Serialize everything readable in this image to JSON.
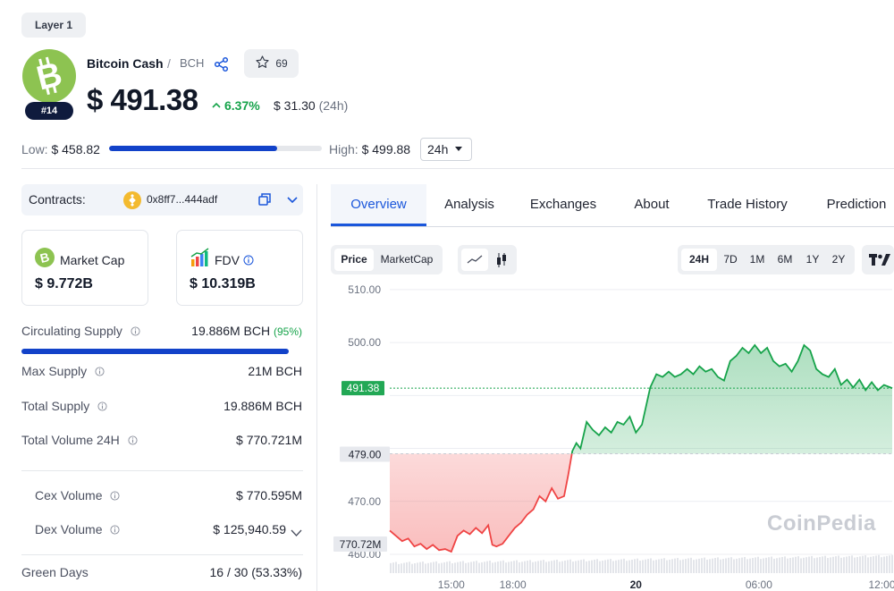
{
  "category_tag": "Layer 1",
  "coin": {
    "name": "Bitcoin Cash",
    "separator": "/",
    "symbol": "BCH",
    "rank": "#14",
    "watchlist_count": "69",
    "price": "$ 491.38",
    "change_pct": "6.37%",
    "change_abs": "$ 31.30",
    "change_period": "(24h)"
  },
  "range": {
    "low_label": "Low:",
    "low_value": "$ 458.82",
    "high_label": "High:",
    "high_value": "$ 499.88",
    "period": "24h",
    "position_fraction": 0.79
  },
  "contracts": {
    "label": "Contracts:",
    "address": "0x8ff7...444adf"
  },
  "cards": {
    "market_cap": {
      "label": "Market Cap",
      "value": "$ 9.772B"
    },
    "fdv": {
      "label": "FDV",
      "value": "$ 10.319B"
    }
  },
  "stats": {
    "circulating_supply": {
      "label": "Circulating Supply",
      "value": "19.886M BCH",
      "pct": "(95%)",
      "fill_fraction": 0.95
    },
    "max_supply": {
      "label": "Max Supply",
      "value": "21M BCH"
    },
    "total_supply": {
      "label": "Total Supply",
      "value": "19.886M BCH"
    },
    "total_volume": {
      "label": "Total Volume 24H",
      "value": "$ 770.721M"
    },
    "cex_volume": {
      "label": "Cex Volume",
      "value": "$ 770.595M"
    },
    "dex_volume": {
      "label": "Dex Volume",
      "value": "$ 125,940.59"
    },
    "green_days": {
      "label": "Green Days",
      "value": "16 / 30 (53.33%)"
    }
  },
  "tabs": [
    "Overview",
    "Analysis",
    "Exchanges",
    "About",
    "Trade History",
    "Prediction"
  ],
  "chart_controls": {
    "data_type": [
      "Price",
      "MarketCap"
    ],
    "data_type_active": "Price",
    "chart_style_active": "line",
    "ranges": [
      "24H",
      "7D",
      "1M",
      "6M",
      "1Y",
      "2Y"
    ],
    "range_active": "24H"
  },
  "watermark": "CoinPedia",
  "colors": {
    "up": "#16a34a",
    "down": "#ef4444",
    "accent": "#1a56db",
    "brand": "#8dc351"
  },
  "chart_data": {
    "type": "area",
    "x_ticks": [
      "15:00",
      "18:00",
      "20",
      "06:00",
      "12:00"
    ],
    "y_ticks": [
      "510.00",
      "500.00",
      "491.38",
      "479.00",
      "470.00",
      "460.00"
    ],
    "ylim": [
      459.5,
      512
    ],
    "baseline": 479.0,
    "last_price_label": "491.38",
    "baseline_label": "479.00",
    "volume_label": "770.72M",
    "x_range": [
      12.0,
      36.5
    ],
    "series": [
      {
        "values": [
          [
            12.0,
            464.5
          ],
          [
            12.3,
            463.5
          ],
          [
            12.6,
            462.5
          ],
          [
            12.9,
            463.0
          ],
          [
            13.2,
            461.5
          ],
          [
            13.5,
            462.0
          ],
          [
            13.8,
            461.0
          ],
          [
            14.1,
            461.8
          ],
          [
            14.4,
            460.8
          ],
          [
            14.7,
            461.0
          ],
          [
            15.0,
            460.5
          ],
          [
            15.3,
            463.5
          ],
          [
            15.6,
            464.5
          ],
          [
            15.9,
            463.8
          ],
          [
            16.2,
            465.0
          ],
          [
            16.5,
            464.0
          ],
          [
            16.8,
            465.5
          ],
          [
            17.0,
            461.8
          ],
          [
            17.2,
            461.5
          ],
          [
            17.5,
            462.0
          ],
          [
            17.8,
            463.5
          ],
          [
            18.1,
            465.0
          ],
          [
            18.4,
            466.0
          ],
          [
            18.7,
            467.5
          ],
          [
            19.0,
            468.5
          ],
          [
            19.3,
            471.0
          ],
          [
            19.6,
            470.0
          ],
          [
            19.9,
            472.5
          ],
          [
            20.2,
            470.5
          ],
          [
            20.5,
            471.0
          ],
          [
            20.7,
            475.0
          ],
          [
            20.9,
            479.5
          ],
          [
            21.1,
            481.0
          ],
          [
            21.3,
            480.0
          ],
          [
            21.6,
            485.0
          ],
          [
            21.9,
            483.5
          ],
          [
            22.2,
            482.5
          ],
          [
            22.5,
            484.0
          ],
          [
            22.8,
            483.0
          ],
          [
            23.1,
            485.0
          ],
          [
            23.4,
            484.5
          ],
          [
            23.7,
            486.0
          ],
          [
            24.0,
            483.0
          ],
          [
            24.3,
            484.5
          ],
          [
            24.5,
            488.0
          ],
          [
            24.7,
            491.5
          ],
          [
            25.0,
            494.0
          ],
          [
            25.3,
            493.5
          ],
          [
            25.6,
            494.5
          ],
          [
            25.9,
            493.5
          ],
          [
            26.2,
            494.0
          ],
          [
            26.5,
            495.0
          ],
          [
            26.8,
            494.0
          ],
          [
            27.1,
            495.5
          ],
          [
            27.4,
            494.5
          ],
          [
            27.7,
            495.0
          ],
          [
            28.0,
            493.5
          ],
          [
            28.3,
            492.8
          ],
          [
            28.6,
            496.5
          ],
          [
            28.9,
            497.5
          ],
          [
            29.2,
            499.0
          ],
          [
            29.5,
            498.0
          ],
          [
            29.8,
            499.5
          ],
          [
            30.1,
            498.0
          ],
          [
            30.4,
            499.0
          ],
          [
            30.7,
            496.5
          ],
          [
            31.0,
            495.5
          ],
          [
            31.3,
            496.0
          ],
          [
            31.6,
            494.5
          ],
          [
            31.9,
            496.5
          ],
          [
            32.2,
            499.5
          ],
          [
            32.5,
            498.5
          ],
          [
            32.8,
            495.0
          ],
          [
            33.1,
            494.0
          ],
          [
            33.4,
            493.5
          ],
          [
            33.7,
            495.0
          ],
          [
            34.0,
            492.0
          ],
          [
            34.3,
            493.0
          ],
          [
            34.6,
            491.5
          ],
          [
            34.9,
            493.0
          ],
          [
            35.2,
            491.0
          ],
          [
            35.5,
            492.5
          ],
          [
            35.8,
            491.0
          ],
          [
            36.1,
            492.0
          ],
          [
            36.5,
            491.38
          ]
        ]
      }
    ]
  }
}
